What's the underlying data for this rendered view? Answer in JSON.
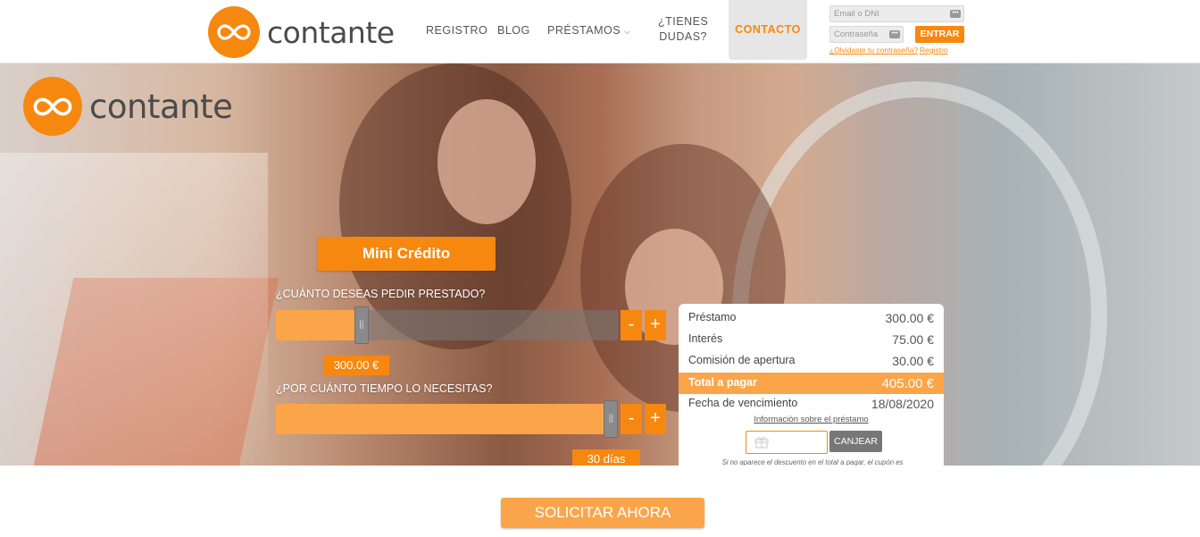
{
  "brand": {
    "name": "contante",
    "color": "#f7880f"
  },
  "nav": {
    "registro": "REGISTRO",
    "blog": "BLOG",
    "prestamos": "PRÉSTAMOS",
    "dudas_line1": "¿TIENES",
    "dudas_line2": "DUDAS?",
    "contacto": "CONTACTO"
  },
  "login": {
    "email_placeholder": "Email o DNI",
    "password_placeholder": "Contraseña",
    "submit": "ENTRAR",
    "forgot": "¿Olvidaste tu contraseña?",
    "register": "Registro"
  },
  "calculator": {
    "title": "Mini Crédito",
    "amount_question": "¿CUÁNTO DESEAS PEDIR PRESTADO?",
    "term_question": "¿POR CUÁNTO TIEMPO LO NECESITAS?",
    "amount_value": "300.00  €",
    "term_value": "30 días",
    "amount_level": 0.25,
    "term_level": 0.98,
    "minus": "-",
    "plus": "+"
  },
  "summary": {
    "rows": [
      {
        "label": "Préstamo",
        "value": "300.00 €"
      },
      {
        "label": "Interés",
        "value": "75.00 €"
      },
      {
        "label": "Comisión de apertura",
        "value": "30.00 €"
      },
      {
        "label": "Total a pagar",
        "value": "405.00 €"
      },
      {
        "label": "Fecha de vencimiento",
        "value": "18/08/2020"
      }
    ],
    "info_link": "Información sobre el préstamo",
    "coupon_button": "CANJEAR",
    "coupon_note": "Si no aparece el descuento en el total a pagar, el cupón es incorrecto o ha caducado."
  },
  "cta": {
    "label": "SOLICITAR AHORA"
  },
  "icons": {
    "logo": "infinity-icon",
    "gift": "gift-icon",
    "chevron": "chevron-down-icon",
    "key": "password-dots-icon"
  }
}
